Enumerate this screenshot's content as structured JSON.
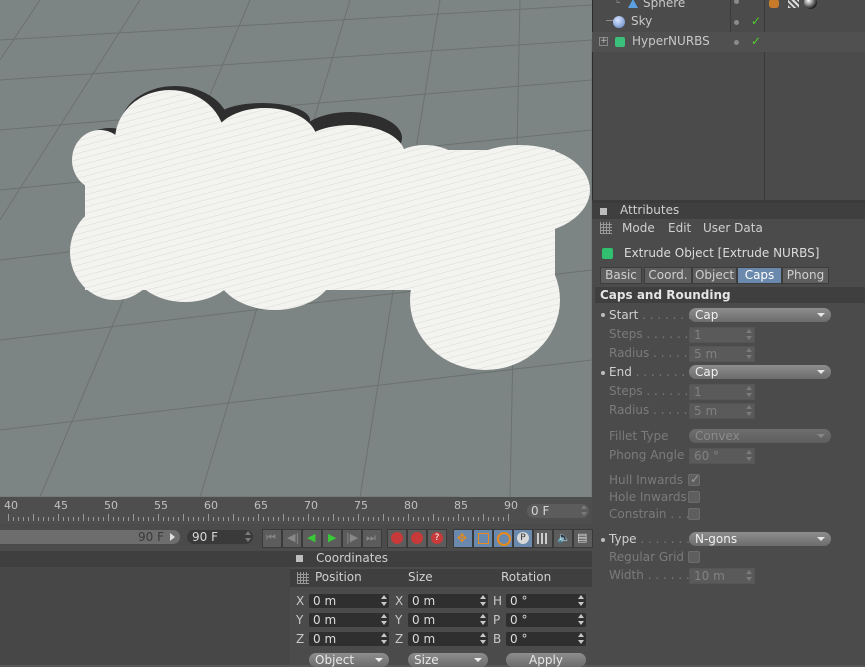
{
  "object_manager": {
    "objects": [
      {
        "name": "Sphere"
      },
      {
        "name": "Sky"
      },
      {
        "name": "HyperNURBS"
      }
    ]
  },
  "attributes": {
    "panel_title": "Attributes",
    "menu": [
      "Mode",
      "Edit",
      "User Data"
    ],
    "object_title": "Extrude Object [Extrude NURBS]",
    "tabs": [
      "Basic",
      "Coord.",
      "Object",
      "Caps",
      "Phong"
    ],
    "active_tab": "Caps",
    "section_title": "Caps and Rounding",
    "start": {
      "label": "Start",
      "value": "Cap"
    },
    "start_steps": {
      "label": "Steps",
      "value": "1"
    },
    "start_radius": {
      "label": "Radius",
      "value": "5 m"
    },
    "end": {
      "label": "End",
      "value": "Cap"
    },
    "end_steps": {
      "label": "Steps",
      "value": "1"
    },
    "end_radius": {
      "label": "Radius",
      "value": "5 m"
    },
    "fillet_type": {
      "label": "Fillet Type",
      "value": "Convex"
    },
    "phong_angle": {
      "label": "Phong Angle",
      "value": "60 °"
    },
    "hull_inwards": {
      "label": "Hull Inwards",
      "checked": true
    },
    "hole_inwards": {
      "label": "Hole Inwards",
      "checked": false
    },
    "constrain": {
      "label": "Constrain",
      "checked": false
    },
    "type": {
      "label": "Type",
      "value": "N-gons"
    },
    "regular_grid": {
      "label": "Regular Grid",
      "checked": false
    },
    "width": {
      "label": "Width",
      "value": "10 m"
    }
  },
  "timeline": {
    "ticks": [
      "40",
      "45",
      "50",
      "55",
      "60",
      "65",
      "70",
      "75",
      "80",
      "85",
      "90"
    ],
    "current_frame": "0 F"
  },
  "transport": {
    "end_frame_display": "90 F",
    "max_frame": "90 F"
  },
  "coordinates": {
    "title": "Coordinates",
    "col_position": "Position",
    "col_size": "Size",
    "col_rotation": "Rotation",
    "position": [
      {
        "axis": "X",
        "value": "0 m"
      },
      {
        "axis": "Y",
        "value": "0 m"
      },
      {
        "axis": "Z",
        "value": "0 m"
      }
    ],
    "size": [
      {
        "axis": "X",
        "value": "0 m"
      },
      {
        "axis": "Y",
        "value": "0 m"
      },
      {
        "axis": "Z",
        "value": "0 m"
      }
    ],
    "rotation": [
      {
        "axis": "H",
        "value": "0 °"
      },
      {
        "axis": "P",
        "value": "0 °"
      },
      {
        "axis": "B",
        "value": "0 °"
      }
    ],
    "mode_dropdown": "Object",
    "size_dropdown": "Size",
    "apply_label": "Apply"
  },
  "colors": {
    "active_tab": "#6a89ad",
    "checkmark": "#4fcf2a",
    "viewport_bg": "#7d8584"
  }
}
